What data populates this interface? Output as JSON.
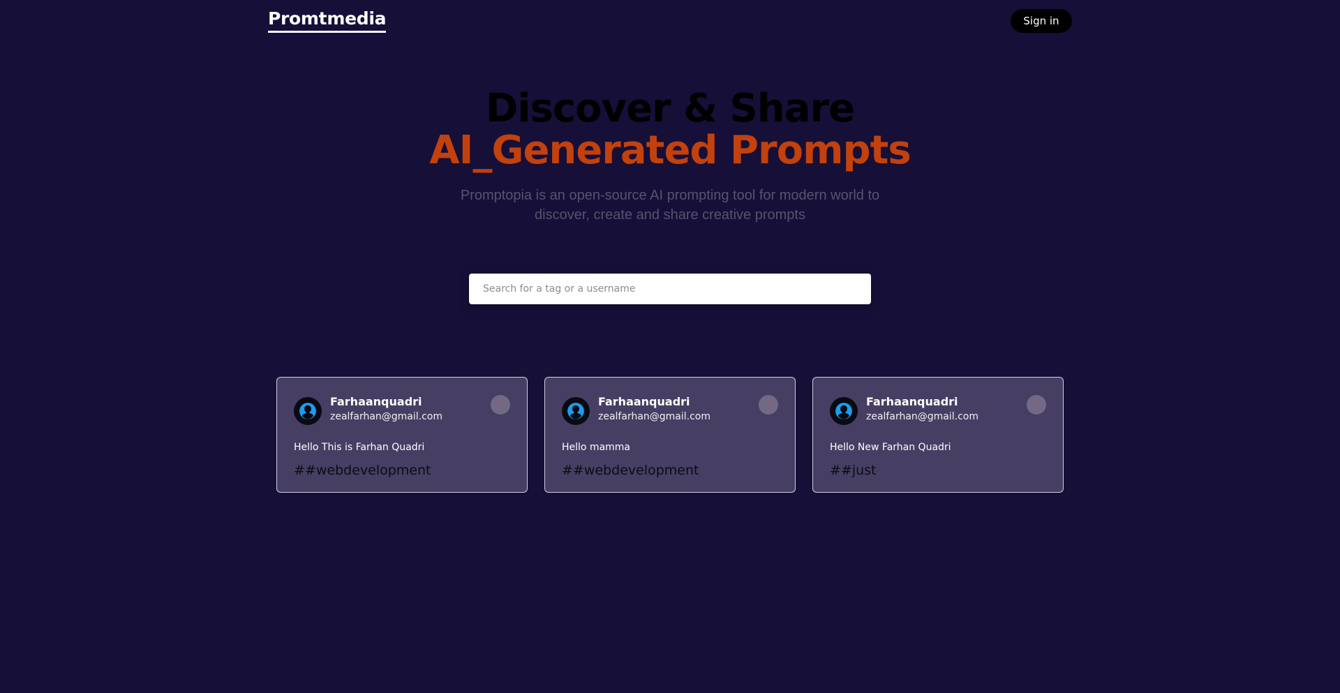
{
  "nav": {
    "brand": "Promtmedia",
    "signin_label": "Sign in"
  },
  "hero": {
    "line1": "Discover & Share",
    "line2": "AI_Generated Prompts",
    "description": "Promptopia is an open-source AI prompting tool for modern world to discover, create and share creative prompts"
  },
  "search": {
    "placeholder": "Search for a tag or a username"
  },
  "colors": {
    "background": "#160f38",
    "accent": "#c2410c",
    "card_bg": "#463f63",
    "avatar_icon": "#1d9bf0"
  },
  "cards": [
    {
      "username": "Farhaanquadri",
      "email": "zealfarhan@gmail.com",
      "prompt": "Hello This is Farhan Quadri",
      "tag": "##webdevelopment",
      "avatar_icon": "user-avatar-icon",
      "copy_icon": "copy-icon"
    },
    {
      "username": "Farhaanquadri",
      "email": "zealfarhan@gmail.com",
      "prompt": "Hello mamma",
      "tag": "##webdevelopment",
      "avatar_icon": "user-avatar-icon",
      "copy_icon": "copy-icon"
    },
    {
      "username": "Farhaanquadri",
      "email": "zealfarhan@gmail.com",
      "prompt": "Hello New Farhan Quadri",
      "tag": "##just",
      "avatar_icon": "user-avatar-icon",
      "copy_icon": "copy-icon"
    }
  ]
}
